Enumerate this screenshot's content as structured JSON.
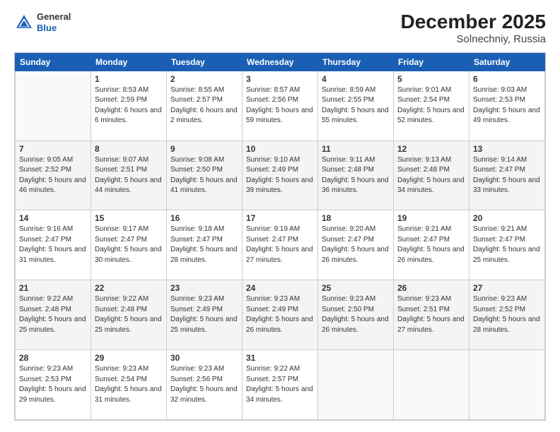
{
  "logo": {
    "general": "General",
    "blue": "Blue"
  },
  "header": {
    "title": "December 2025",
    "subtitle": "Solnechniy, Russia"
  },
  "weekdays": [
    "Sunday",
    "Monday",
    "Tuesday",
    "Wednesday",
    "Thursday",
    "Friday",
    "Saturday"
  ],
  "weeks": [
    [
      {
        "day": "",
        "sunrise": "",
        "sunset": "",
        "daylight": ""
      },
      {
        "day": "1",
        "sunrise": "Sunrise: 8:53 AM",
        "sunset": "Sunset: 2:59 PM",
        "daylight": "Daylight: 6 hours and 6 minutes."
      },
      {
        "day": "2",
        "sunrise": "Sunrise: 8:55 AM",
        "sunset": "Sunset: 2:57 PM",
        "daylight": "Daylight: 6 hours and 2 minutes."
      },
      {
        "day": "3",
        "sunrise": "Sunrise: 8:57 AM",
        "sunset": "Sunset: 2:56 PM",
        "daylight": "Daylight: 5 hours and 59 minutes."
      },
      {
        "day": "4",
        "sunrise": "Sunrise: 8:59 AM",
        "sunset": "Sunset: 2:55 PM",
        "daylight": "Daylight: 5 hours and 55 minutes."
      },
      {
        "day": "5",
        "sunrise": "Sunrise: 9:01 AM",
        "sunset": "Sunset: 2:54 PM",
        "daylight": "Daylight: 5 hours and 52 minutes."
      },
      {
        "day": "6",
        "sunrise": "Sunrise: 9:03 AM",
        "sunset": "Sunset: 2:53 PM",
        "daylight": "Daylight: 5 hours and 49 minutes."
      }
    ],
    [
      {
        "day": "7",
        "sunrise": "Sunrise: 9:05 AM",
        "sunset": "Sunset: 2:52 PM",
        "daylight": "Daylight: 5 hours and 46 minutes."
      },
      {
        "day": "8",
        "sunrise": "Sunrise: 9:07 AM",
        "sunset": "Sunset: 2:51 PM",
        "daylight": "Daylight: 5 hours and 44 minutes."
      },
      {
        "day": "9",
        "sunrise": "Sunrise: 9:08 AM",
        "sunset": "Sunset: 2:50 PM",
        "daylight": "Daylight: 5 hours and 41 minutes."
      },
      {
        "day": "10",
        "sunrise": "Sunrise: 9:10 AM",
        "sunset": "Sunset: 2:49 PM",
        "daylight": "Daylight: 5 hours and 39 minutes."
      },
      {
        "day": "11",
        "sunrise": "Sunrise: 9:11 AM",
        "sunset": "Sunset: 2:48 PM",
        "daylight": "Daylight: 5 hours and 36 minutes."
      },
      {
        "day": "12",
        "sunrise": "Sunrise: 9:13 AM",
        "sunset": "Sunset: 2:48 PM",
        "daylight": "Daylight: 5 hours and 34 minutes."
      },
      {
        "day": "13",
        "sunrise": "Sunrise: 9:14 AM",
        "sunset": "Sunset: 2:47 PM",
        "daylight": "Daylight: 5 hours and 33 minutes."
      }
    ],
    [
      {
        "day": "14",
        "sunrise": "Sunrise: 9:16 AM",
        "sunset": "Sunset: 2:47 PM",
        "daylight": "Daylight: 5 hours and 31 minutes."
      },
      {
        "day": "15",
        "sunrise": "Sunrise: 9:17 AM",
        "sunset": "Sunset: 2:47 PM",
        "daylight": "Daylight: 5 hours and 30 minutes."
      },
      {
        "day": "16",
        "sunrise": "Sunrise: 9:18 AM",
        "sunset": "Sunset: 2:47 PM",
        "daylight": "Daylight: 5 hours and 28 minutes."
      },
      {
        "day": "17",
        "sunrise": "Sunrise: 9:19 AM",
        "sunset": "Sunset: 2:47 PM",
        "daylight": "Daylight: 5 hours and 27 minutes."
      },
      {
        "day": "18",
        "sunrise": "Sunrise: 9:20 AM",
        "sunset": "Sunset: 2:47 PM",
        "daylight": "Daylight: 5 hours and 26 minutes."
      },
      {
        "day": "19",
        "sunrise": "Sunrise: 9:21 AM",
        "sunset": "Sunset: 2:47 PM",
        "daylight": "Daylight: 5 hours and 26 minutes."
      },
      {
        "day": "20",
        "sunrise": "Sunrise: 9:21 AM",
        "sunset": "Sunset: 2:47 PM",
        "daylight": "Daylight: 5 hours and 25 minutes."
      }
    ],
    [
      {
        "day": "21",
        "sunrise": "Sunrise: 9:22 AM",
        "sunset": "Sunset: 2:48 PM",
        "daylight": "Daylight: 5 hours and 25 minutes."
      },
      {
        "day": "22",
        "sunrise": "Sunrise: 9:22 AM",
        "sunset": "Sunset: 2:48 PM",
        "daylight": "Daylight: 5 hours and 25 minutes."
      },
      {
        "day": "23",
        "sunrise": "Sunrise: 9:23 AM",
        "sunset": "Sunset: 2:49 PM",
        "daylight": "Daylight: 5 hours and 25 minutes."
      },
      {
        "day": "24",
        "sunrise": "Sunrise: 9:23 AM",
        "sunset": "Sunset: 2:49 PM",
        "daylight": "Daylight: 5 hours and 26 minutes."
      },
      {
        "day": "25",
        "sunrise": "Sunrise: 9:23 AM",
        "sunset": "Sunset: 2:50 PM",
        "daylight": "Daylight: 5 hours and 26 minutes."
      },
      {
        "day": "26",
        "sunrise": "Sunrise: 9:23 AM",
        "sunset": "Sunset: 2:51 PM",
        "daylight": "Daylight: 5 hours and 27 minutes."
      },
      {
        "day": "27",
        "sunrise": "Sunrise: 9:23 AM",
        "sunset": "Sunset: 2:52 PM",
        "daylight": "Daylight: 5 hours and 28 minutes."
      }
    ],
    [
      {
        "day": "28",
        "sunrise": "Sunrise: 9:23 AM",
        "sunset": "Sunset: 2:53 PM",
        "daylight": "Daylight: 5 hours and 29 minutes."
      },
      {
        "day": "29",
        "sunrise": "Sunrise: 9:23 AM",
        "sunset": "Sunset: 2:54 PM",
        "daylight": "Daylight: 5 hours and 31 minutes."
      },
      {
        "day": "30",
        "sunrise": "Sunrise: 9:23 AM",
        "sunset": "Sunset: 2:56 PM",
        "daylight": "Daylight: 5 hours and 32 minutes."
      },
      {
        "day": "31",
        "sunrise": "Sunrise: 9:22 AM",
        "sunset": "Sunset: 2:57 PM",
        "daylight": "Daylight: 5 hours and 34 minutes."
      },
      {
        "day": "",
        "sunrise": "",
        "sunset": "",
        "daylight": ""
      },
      {
        "day": "",
        "sunrise": "",
        "sunset": "",
        "daylight": ""
      },
      {
        "day": "",
        "sunrise": "",
        "sunset": "",
        "daylight": ""
      }
    ]
  ]
}
